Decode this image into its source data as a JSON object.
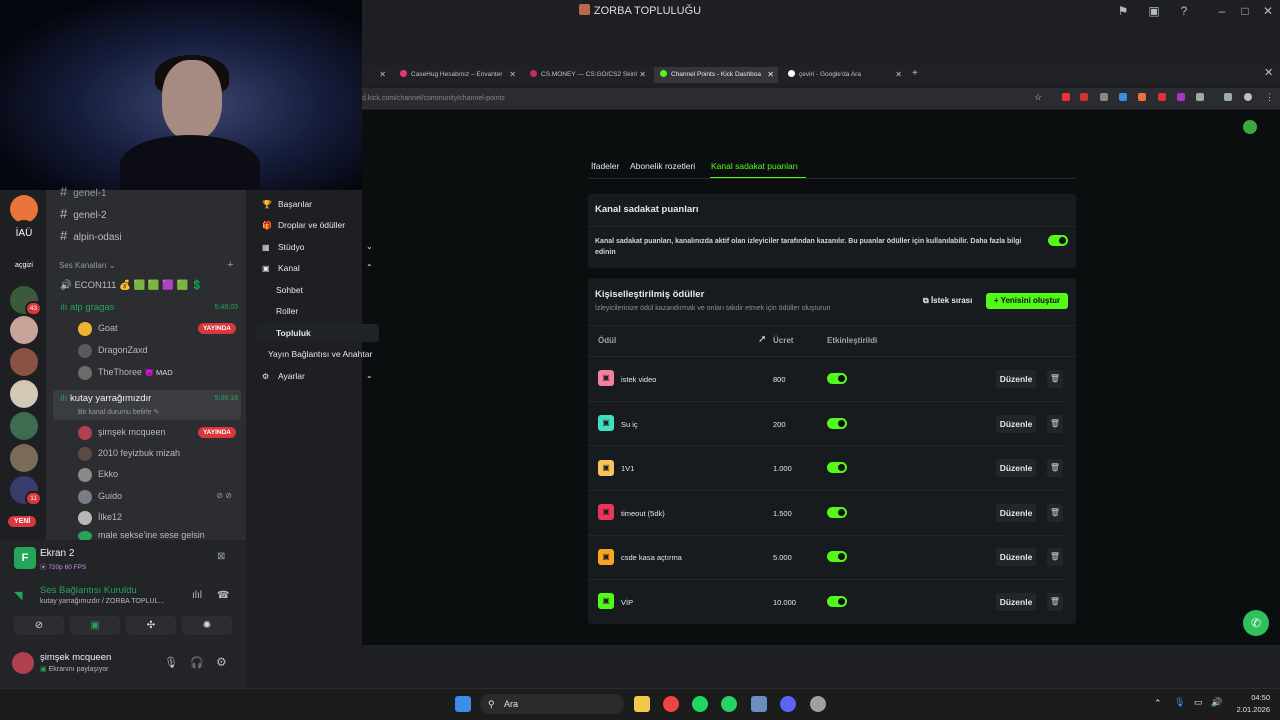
{
  "window": {
    "title": "ZORBA TOPLULUĞU"
  },
  "browser": {
    "tabs": [
      {
        "label": "CaseHug Hesabınız – Envanter",
        "color": "#e33b6f"
      },
      {
        "label": "CS.MONEY — CS:GO/CS2 Skinl",
        "color": "#c22c5a"
      },
      {
        "label": "Channel Points - Kick Dashboa",
        "color": "#53fc18"
      },
      {
        "label": "çeviri - Google'da Ara",
        "color": "#ffffff"
      }
    ],
    "url": "d.kick.com/channel/community/channel-points"
  },
  "discord": {
    "servers": [
      {
        "label": "",
        "color": "#e8743b"
      },
      {
        "label": "İAÜ",
        "color": "#1e1f22"
      },
      {
        "label": "açgizi",
        "color": "#1e1f22"
      },
      {
        "label": "",
        "color": "#3b5a3b",
        "badge": "43"
      },
      {
        "label": "",
        "color": "#c7a49a"
      },
      {
        "label": "",
        "color": "#8a5244"
      },
      {
        "label": "",
        "color": "#d3c7b6"
      },
      {
        "label": "",
        "color": "#3d6d4f"
      },
      {
        "label": "",
        "color": "#7a6a58"
      },
      {
        "label": "",
        "color": "#3a3c6c",
        "badge": "11"
      }
    ],
    "new_label": "YENİ",
    "text_channels": [
      "genel-1",
      "genel-2",
      "alpin-odasi"
    ],
    "voice_header": "Ses Kanalları",
    "voice_channels": [
      {
        "name": "ECON111 💰 🟩 🟩 🟪 🟩 💲",
        "time": ""
      },
      {
        "name": "alp gragas",
        "time": "5:48:03",
        "users": [
          {
            "name": "Goat",
            "live": true,
            "color": "#f0b232"
          },
          {
            "name": "DragonZaxd",
            "live": false,
            "color": "#5a5a5a"
          },
          {
            "name": "TheThoree",
            "tag": "😈 MAD",
            "live": false,
            "color": "#6b6b6b"
          }
        ]
      },
      {
        "name": "kutay yarrağımızdır",
        "status": "Bir kanal durumu belirle",
        "time": "5:06:18",
        "users": [
          {
            "name": "şimşek mcqueen",
            "live": true,
            "color": "#b04050"
          },
          {
            "name": "2010 feyizbuk mizah",
            "live": false,
            "color": "#5a4a44"
          },
          {
            "name": "Ekko",
            "live": false,
            "color": "#8a8a8a"
          },
          {
            "name": "Guido",
            "live": false,
            "color": "#7a7c88"
          },
          {
            "name": "İlke12",
            "live": false,
            "color": "#b8b8b8"
          },
          {
            "name": "male sekse'ine sese gelsin",
            "live": false,
            "color": "#23a55a"
          }
        ]
      }
    ],
    "live_label": "YAYINDA",
    "stream": {
      "title": "Ekran 2",
      "quality": "720p 60 FPS",
      "avatar_letter": "F"
    },
    "voice_status": {
      "title": "Ses Bağlantısı Kuruldu",
      "subtitle": "kutay yarrağımızdır / ZORBA TOPLUL..."
    },
    "user": {
      "name": "şimşek mcqueen",
      "status": "Ekranını paylaşıyor"
    }
  },
  "kick_menu": {
    "items": [
      {
        "label": "Başarılar",
        "icon": "🏆"
      },
      {
        "label": "Droplar ve ödüller",
        "icon": "🎁"
      },
      {
        "label": "Stüdyo",
        "icon": "▦",
        "chevron": "down"
      },
      {
        "label": "Kanal",
        "icon": "▣",
        "chevron": "up"
      }
    ],
    "sub_items": [
      "Sohbet",
      "Roller",
      "Topluluk"
    ],
    "more": [
      {
        "label": "Yayın Bağlantısı ve Anahtar",
        "icon": ""
      },
      {
        "label": "Ayarlar",
        "icon": "⚙",
        "chevron": "down"
      }
    ]
  },
  "kick_main": {
    "tabs": [
      "İfadeler",
      "Abonelik rozetleri",
      "Kanal sadakat puanları"
    ],
    "loyalty_card": {
      "title": "Kanal sadakat puanları",
      "description": "Kanal sadakat puanları, kanalınızda aktif olan izleyiciler tarafından kazanılır. Bu puanlar ödüller için kullanılabilir.",
      "link": "Daha fazla bilgi edinin",
      "enabled": true
    },
    "rewards_card": {
      "title": "Kişiselleştirilmiş ödüller",
      "subtitle": "İzleyicilerinize ödül kazandırmak ve onları takdir etmek için ödüller oluşturun",
      "queue_button": "İstek sırası",
      "create_button": "Yenisini oluştur",
      "columns": [
        "Ödül",
        "Ücret",
        "Etkinleştirildi"
      ],
      "edit_label": "Düzenle",
      "rows": [
        {
          "name": "istek video",
          "cost": "800",
          "color": "#f47fa0",
          "enabled": true
        },
        {
          "name": "Su iç",
          "cost": "200",
          "color": "#3fe0c0",
          "enabled": true
        },
        {
          "name": "1V1",
          "cost": "1.000",
          "color": "#f6c45a",
          "enabled": true
        },
        {
          "name": "timeout (5dk)",
          "cost": "1.500",
          "color": "#e8385a",
          "enabled": true
        },
        {
          "name": "csde kasa açtırma",
          "cost": "5.000",
          "color": "#f5a623",
          "enabled": true
        },
        {
          "name": "VİP",
          "cost": "10.000",
          "color": "#53fc18",
          "enabled": true
        }
      ]
    }
  },
  "taskbar": {
    "search_placeholder": "Ara",
    "time": "04:50",
    "date": "2.01.2026"
  }
}
